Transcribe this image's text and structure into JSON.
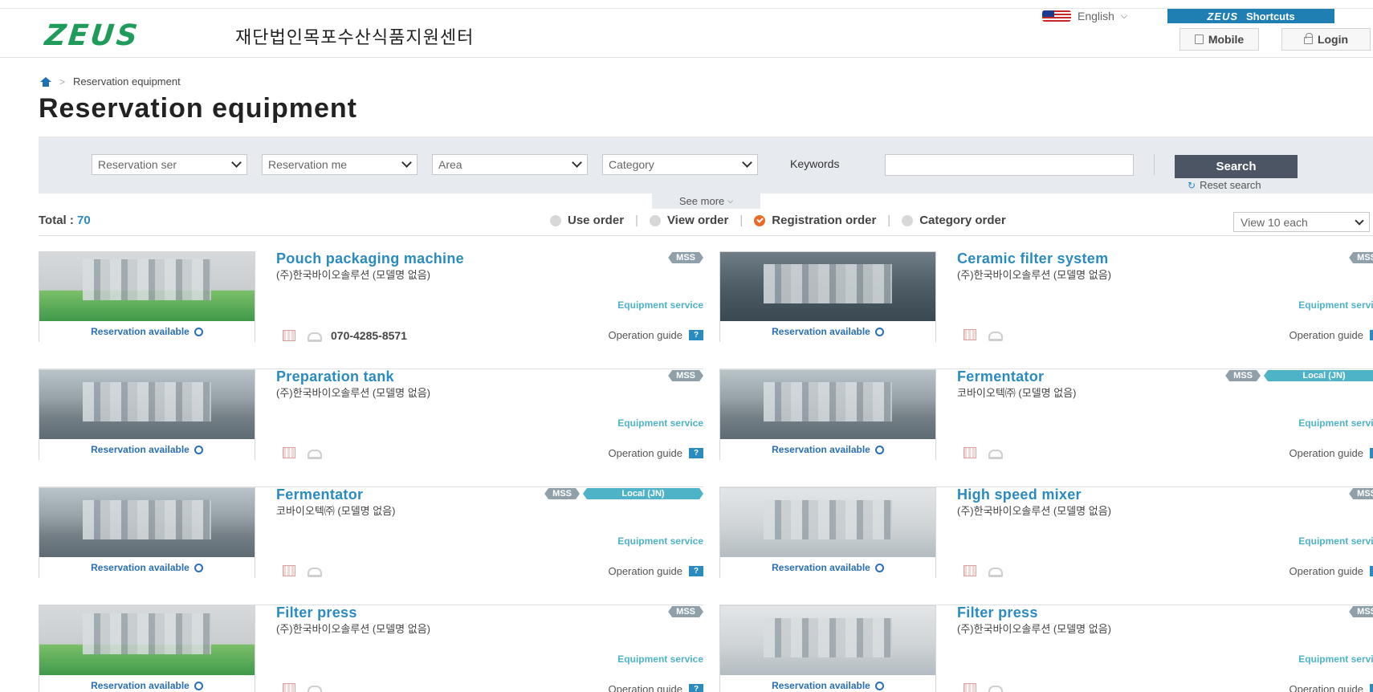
{
  "header": {
    "logo_text": "ZEUS",
    "site_name": "재단법인목포수산식품지원센터",
    "language": "English",
    "shortcuts_logo": "ZEUS",
    "shortcuts_label": "Shortcuts",
    "mobile_label": "Mobile",
    "login_label": "Login",
    "brand_color": "#1f9c5a"
  },
  "breadcrumb": {
    "current": "Reservation equipment"
  },
  "page_title": "Reservation equipment",
  "filters": {
    "reservation_service": "Reservation ser",
    "reservation_method": "Reservation me",
    "area": "Area",
    "category": "Category",
    "keywords_label": "Keywords",
    "keywords_value": "",
    "search_label": "Search",
    "reset_label": "Reset search",
    "see_more": "See more"
  },
  "list": {
    "total_label": "Total : ",
    "total_value": "70",
    "sort": [
      "Use order",
      "View order",
      "Registration order",
      "Category order"
    ],
    "active_sort": "Registration order",
    "per_page": "View 10 each"
  },
  "cards": [
    {
      "title": "Pouch packaging machine",
      "maker": "(주)한국바이오솔루션 (모델명 없음)",
      "tags": [
        "MSS"
      ],
      "service": "Equipment service",
      "status": "Reservation available",
      "phone": "070-4285-8571",
      "guide": "Operation guide",
      "image": "green"
    },
    {
      "title": "Ceramic filter system",
      "maker": "(주)한국바이오솔루션 (모델명 없음)",
      "tags": [
        "MSS"
      ],
      "service": "Equipment service",
      "status": "Reservation available",
      "phone": "",
      "guide": "Operation guide",
      "image": "blue"
    },
    {
      "title": "Preparation tank",
      "maker": "(주)한국바이오솔루션 (모델명 없음)",
      "tags": [
        "MSS"
      ],
      "service": "Equipment service",
      "status": "Reservation available",
      "phone": "",
      "guide": "Operation guide",
      "image": "default"
    },
    {
      "title": "Fermentator",
      "maker": "코바이오텍㈜ (모델명 없음)",
      "tags": [
        "MSS",
        "Local (JN)"
      ],
      "service": "Equipment service",
      "status": "Reservation available",
      "phone": "",
      "guide": "Operation guide",
      "image": "default"
    },
    {
      "title": "Fermentator",
      "maker": "코바이오텍㈜ (모델명 없음)",
      "tags": [
        "MSS",
        "Local (JN)"
      ],
      "service": "Equipment service",
      "status": "Reservation available",
      "phone": "",
      "guide": "Operation guide",
      "image": "default"
    },
    {
      "title": "High speed mixer",
      "maker": "(주)한국바이오솔루션 (모델명 없음)",
      "tags": [
        "MSS"
      ],
      "service": "Equipment service",
      "status": "Reservation available",
      "phone": "",
      "guide": "Operation guide",
      "image": "light"
    },
    {
      "title": "Filter press",
      "maker": "(주)한국바이오솔루션 (모델명 없음)",
      "tags": [
        "MSS"
      ],
      "service": "Equipment service",
      "status": "Reservation available",
      "phone": "",
      "guide": "Operation guide",
      "image": "green"
    },
    {
      "title": "Filter press",
      "maker": "(주)한국바이오솔루션 (모델명 없음)",
      "tags": [
        "MSS"
      ],
      "service": "Equipment service",
      "status": "Reservation available",
      "phone": "",
      "guide": "Operation guide",
      "image": "light"
    }
  ]
}
